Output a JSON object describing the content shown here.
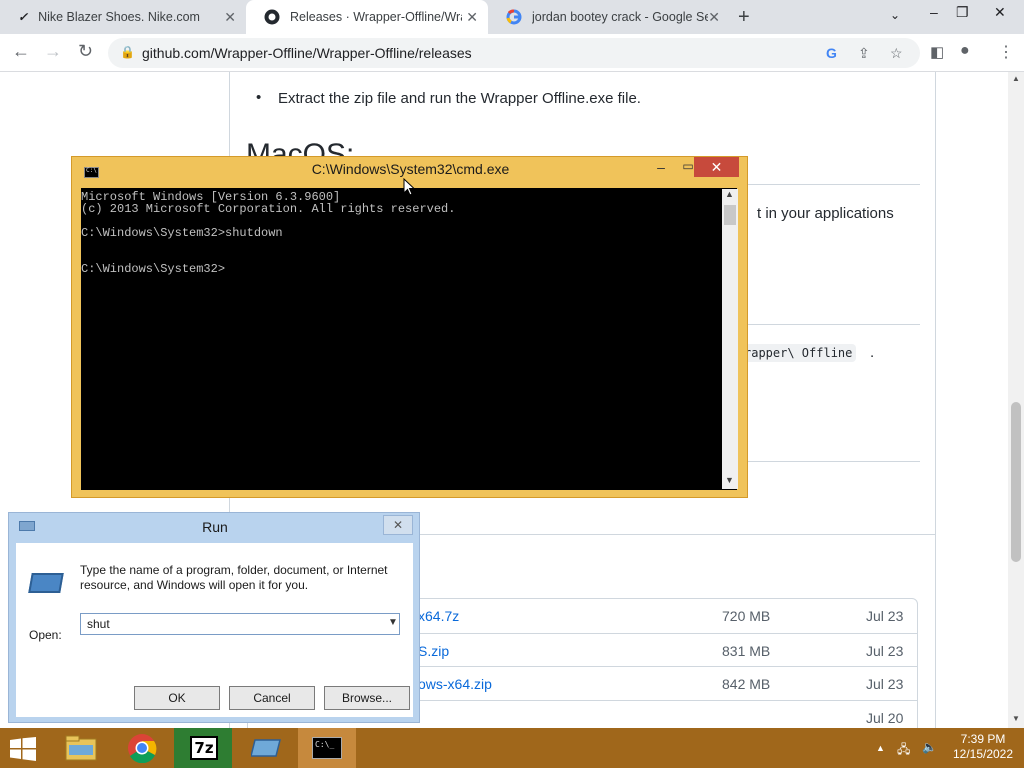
{
  "browser": {
    "tabs": [
      {
        "label": "Nike Blazer Shoes. Nike.com",
        "icon": "nike-icon"
      },
      {
        "label": "Releases · Wrapper-Offline/Wrap",
        "icon": "github-icon",
        "active": true
      },
      {
        "label": "jordan bootey crack - Google Se",
        "icon": "google-icon"
      }
    ],
    "url": "github.com/Wrapper-Offline/Wrapper-Offline/releases"
  },
  "page": {
    "bullet": "Extract the zip file and run the Wrapper Offline.exe file.",
    "heading": "MacOS:",
    "text_applications": "t in your applications",
    "code_text": "rapper\\ Offline",
    "code_tail": ".",
    "assets": [
      {
        "name": "x64.7z",
        "size": "720 MB",
        "date": "Jul 23"
      },
      {
        "name": "S.zip",
        "size": "831 MB",
        "date": "Jul 23"
      },
      {
        "name": "ows-x64.zip",
        "size": "842 MB",
        "date": "Jul 23"
      },
      {
        "name": "",
        "size": "",
        "date": "Jul 20"
      }
    ]
  },
  "cmd": {
    "title": "C:\\Windows\\System32\\cmd.exe",
    "lines": [
      "Microsoft Windows [Version 6.3.9600]",
      "(c) 2013 Microsoft Corporation. All rights reserved.",
      "",
      "C:\\Windows\\System32>shutdown",
      "",
      "",
      "C:\\Windows\\System32>"
    ]
  },
  "run": {
    "title": "Run",
    "description": "Type the name of a program, folder, document, or Internet resource, and Windows will open it for you.",
    "open_label": "Open:",
    "value": "shut",
    "ok": "OK",
    "cancel": "Cancel",
    "browse": "Browse..."
  },
  "taskbar": {
    "apps": [
      "file-explorer-icon",
      "chrome-icon",
      "7zip-icon",
      "run-icon",
      "cmd-icon"
    ],
    "time": "7:39 PM",
    "date": "12/15/2022"
  }
}
